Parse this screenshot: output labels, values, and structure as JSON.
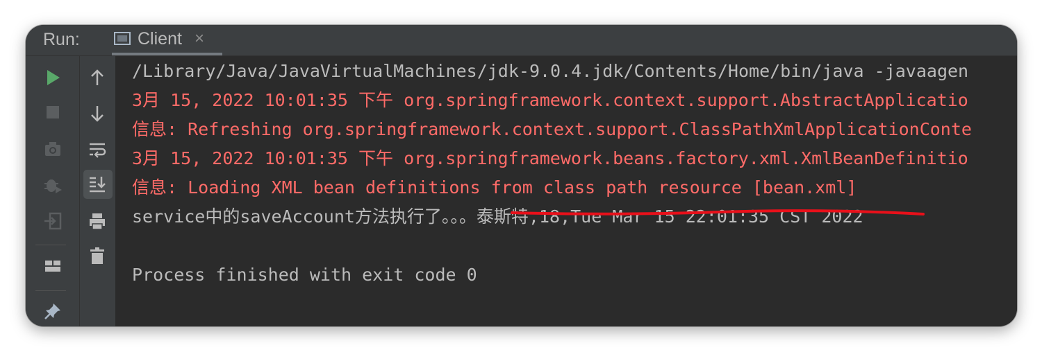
{
  "header": {
    "run_label": "Run:",
    "tab_label": "Client",
    "tab_close": "×"
  },
  "toolbar": {
    "left_icons": [
      "play-icon",
      "stop-icon",
      "camera-icon",
      "debug-icon",
      "login-icon",
      "layout-icon",
      "pin-icon"
    ],
    "right_icons": [
      "arrow-up-icon",
      "arrow-down-icon",
      "soft-wrap-icon",
      "scroll-to-end-icon",
      "print-icon",
      "trash-icon"
    ]
  },
  "console": {
    "lines": [
      {
        "text": "/Library/Java/JavaVirtualMachines/jdk-9.0.4.jdk/Contents/Home/bin/java -javaagen",
        "color": "#bbbbbb"
      },
      {
        "text": "3月 15, 2022 10:01:35 下午 org.springframework.context.support.AbstractApplicatio",
        "color": "#ff6b68"
      },
      {
        "text": "信息: Refreshing org.springframework.context.support.ClassPathXmlApplicationConte",
        "color": "#ff6b68"
      },
      {
        "text": "3月 15, 2022 10:01:35 下午 org.springframework.beans.factory.xml.XmlBeanDefinitio",
        "color": "#ff6b68"
      },
      {
        "text": "信息: Loading XML bean definitions from class path resource [bean.xml]",
        "color": "#ff6b68"
      },
      {
        "text": "service中的saveAccount方法执行了。。。泰斯特,18,Tue Mar 15 22:01:35 CST 2022",
        "color": "#bbbbbb"
      },
      {
        "text": "",
        "color": "#bbbbbb"
      },
      {
        "text": "Process finished with exit code 0",
        "color": "#bbbbbb"
      }
    ]
  },
  "colors": {
    "background": "#2b2b2b",
    "panel": "#3c3f41",
    "error_text": "#ff6b68",
    "normal_text": "#bbbbbb",
    "run_green": "#59a869",
    "annotation_red": "#e8101a"
  }
}
